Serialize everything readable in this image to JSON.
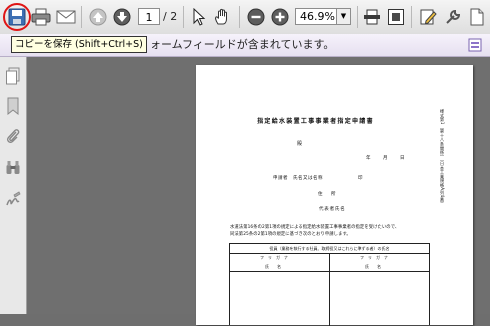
{
  "toolbar": {
    "page_current": "1",
    "page_total": "/ 2",
    "zoom": "46.9%",
    "tooltip": "コピーを保存 (Shift+Ctrl+S)"
  },
  "notice": {
    "text": "ォームフィールドが含まれています。"
  },
  "document": {
    "title": "指定給水装置工事事業者指定申請書",
    "side_text": "様式第1（第十八条関係）（日本工業規格A列4番）",
    "addressee": "殿",
    "date_line": "年　月　日",
    "applicant_line": "申請者　氏名又は名称　　　　　　　印",
    "address_label": "住　所",
    "representative": "代表者氏名",
    "body_line1": "水道法第16条の2第1項の規定による指定給水装置工事事業者の指定を受けたいので、",
    "body_line2": "同法第25条の2第1項の規定に基づき次のとおり申請します。",
    "table_header": "役員（業務を執行する社員、取締役又はこれらに準ずる者）の氏名",
    "furigana": "フ　リ　ガ　ナ",
    "name_col": "氏　　名"
  },
  "colors": {
    "accent_red": "#e01515",
    "notice_bg": "#efe9f7"
  }
}
